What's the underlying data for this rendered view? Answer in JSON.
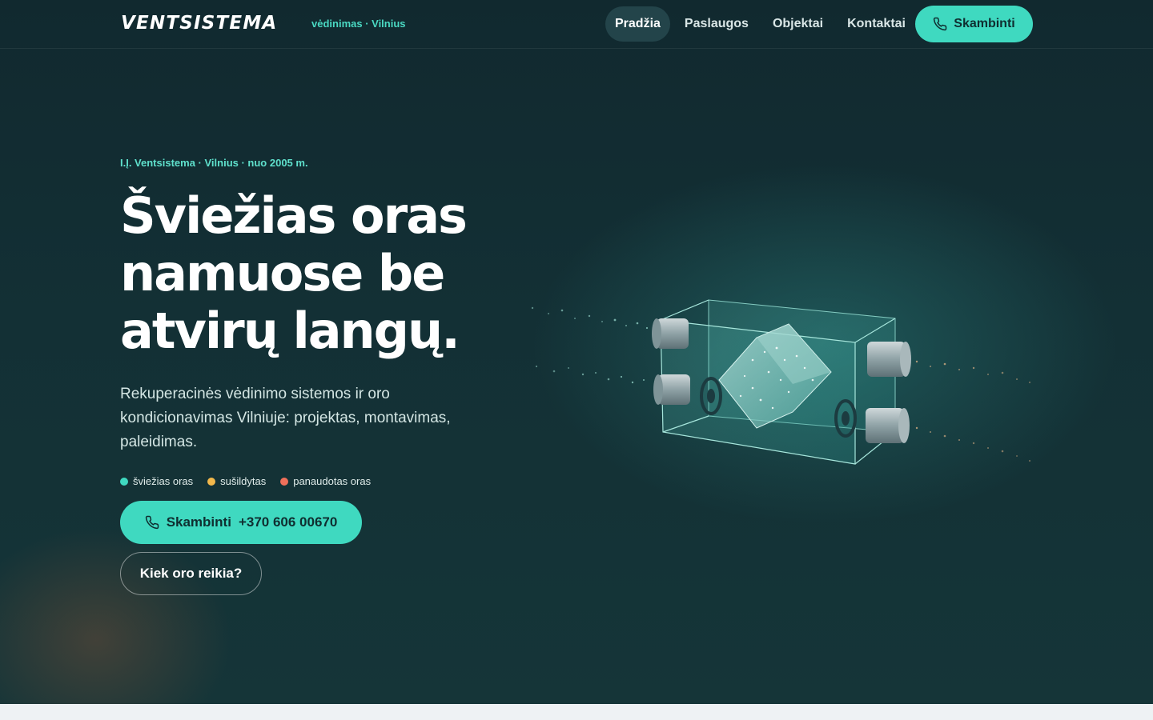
{
  "header": {
    "logo": "VENTSISTEMA",
    "logo_sub": "vėdinimas · Vilnius",
    "nav": [
      {
        "label": "Pradžia",
        "active": true
      },
      {
        "label": "Paslaugos",
        "active": false
      },
      {
        "label": "Objektai",
        "active": false
      },
      {
        "label": "Kontaktai",
        "active": false
      }
    ],
    "call_label": "Skambinti",
    "call_icon": "phone-icon"
  },
  "hero": {
    "eyebrow": "I.Į. Ventsistema · Vilnius · nuo 2005 m.",
    "headline": [
      "Šviežias oras",
      "namuose be",
      "atvirų langų."
    ],
    "lead": "Rekuperacinės vėdinimo sistemos ir oro kondicionavimas Vilniuje: projektas, montavimas, paleidimas.",
    "legend": [
      {
        "label": "šviežias oras",
        "color": "#3fd9c0"
      },
      {
        "label": "sušildytas",
        "color": "#f2b84b"
      },
      {
        "label": "panaudotas oras",
        "color": "#f0705a"
      }
    ],
    "cta_primary_label": "Skambinti",
    "cta_primary_phone": "+370 606 00670",
    "cta_secondary_label": "Kiek oro reikia?",
    "illustration_icon": "heat-recovery-unit-illustration"
  },
  "colors": {
    "accent": "#3fd9c0",
    "background": "#133035",
    "warm": "#f2b84b",
    "exhaust": "#f0705a"
  }
}
